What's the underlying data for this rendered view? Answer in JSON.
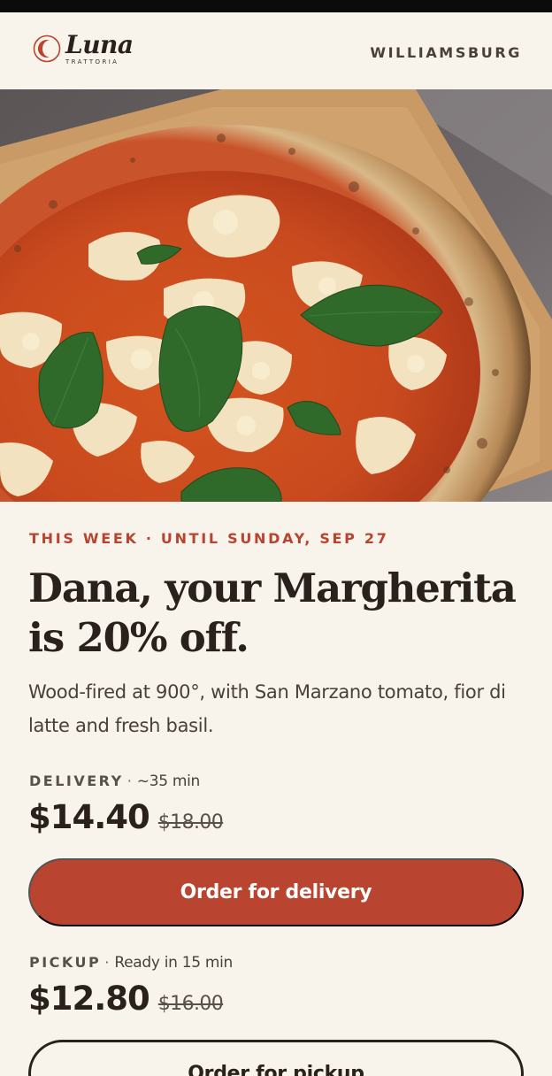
{
  "brand": {
    "name": "Luna",
    "tagline": "TRATTORIA",
    "accent_color": "#b94430"
  },
  "header": {
    "location": "WILLIAMSBURG"
  },
  "hero": {
    "image_icon": "margherita-pizza-photo"
  },
  "promo": {
    "eyebrow": "THIS WEEK · UNTIL SUNDAY, SEP 27",
    "headline": "Dana, your Margherita is 20% off.",
    "description": "Wood-fired at 900°, with San Marzano tomato, fior di latte and fresh basil."
  },
  "delivery": {
    "label": "DELIVERY",
    "separator": "·",
    "eta": "~35 min",
    "price": "$14.40",
    "old_price": "$18.00",
    "button_label": "Order for delivery"
  },
  "pickup": {
    "label": "PICKUP",
    "separator": "·",
    "eta": "Ready in 15 min",
    "price": "$12.80",
    "old_price": "$16.00",
    "button_label": "Order for pickup"
  }
}
